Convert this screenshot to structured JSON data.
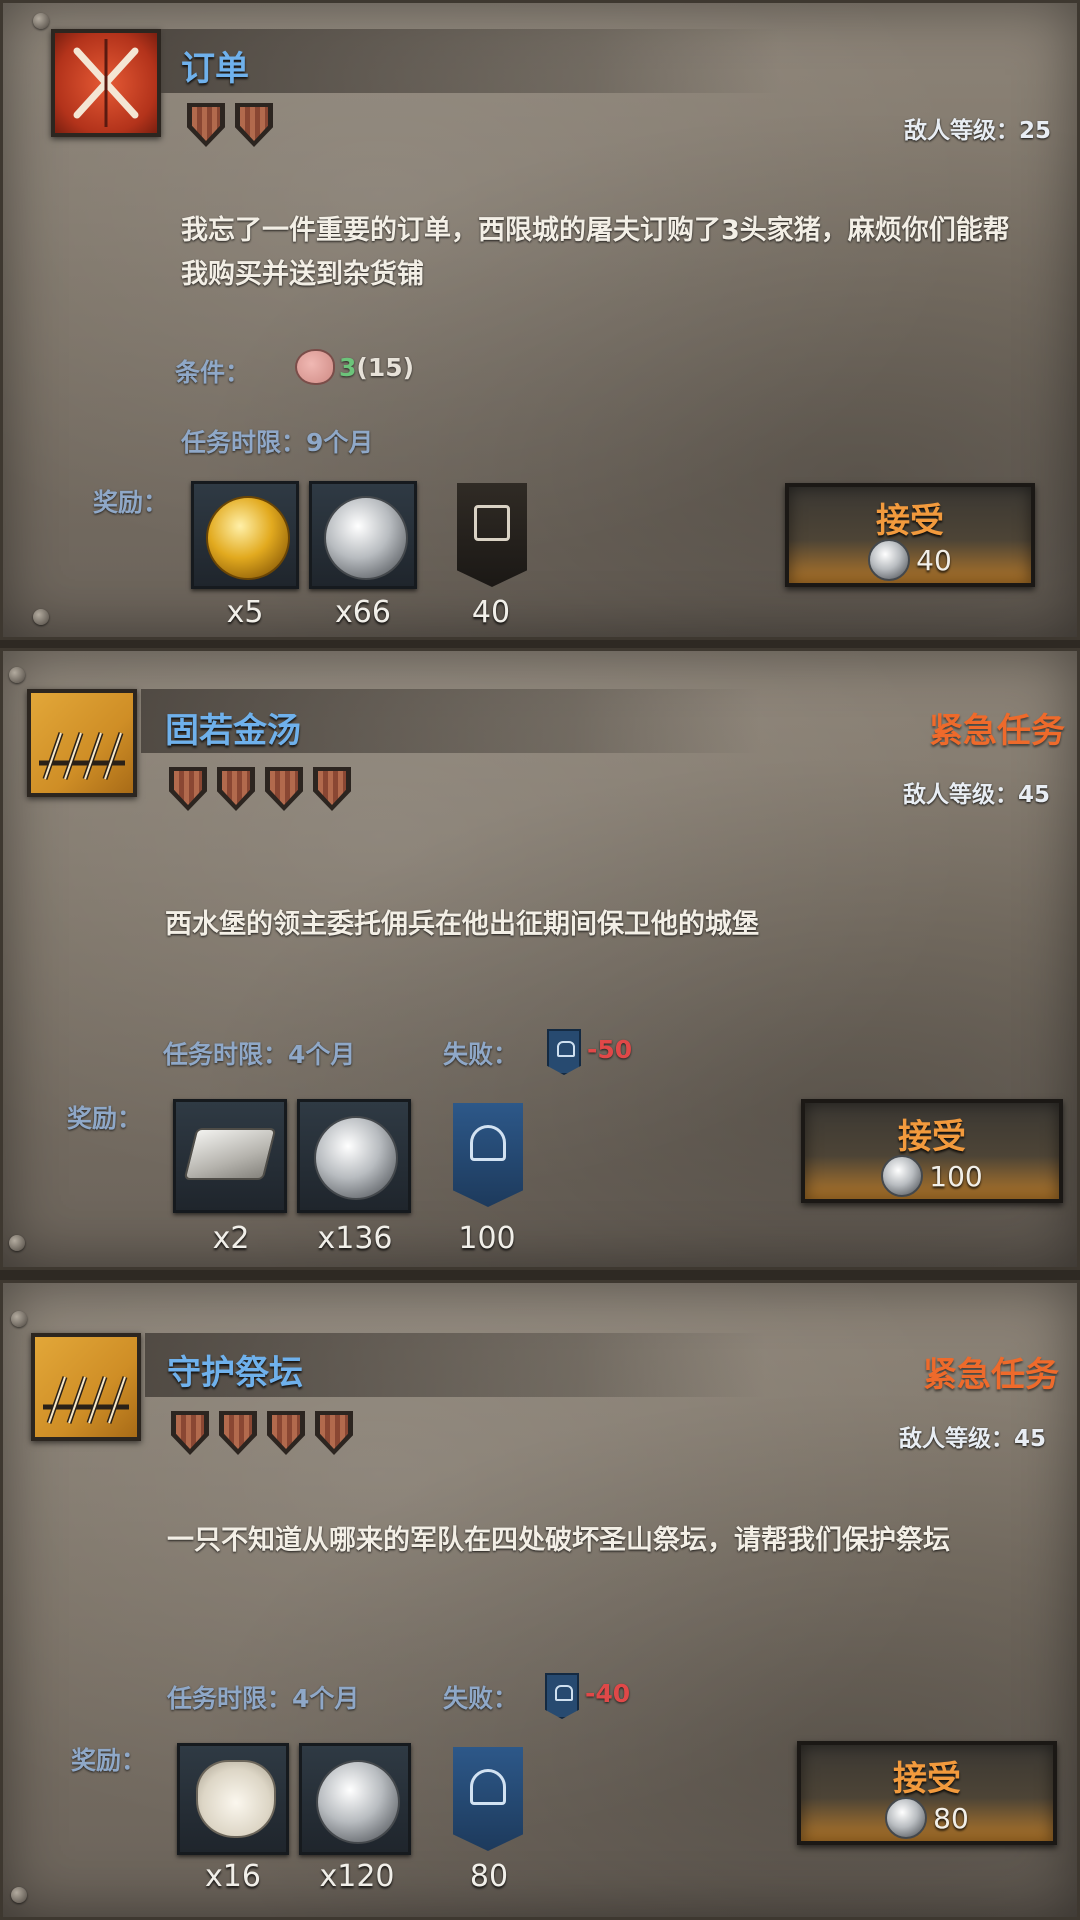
{
  "labels": {
    "enemy_level_prefix": "敌人等级：",
    "condition": "条件：",
    "time_limit": "任务时限：",
    "fail": "失败：",
    "reward": "奖励：",
    "accept": "接受",
    "urgent": "紧急任务"
  },
  "quests": [
    {
      "title": "订单",
      "difficulty_shields": 2,
      "enemy_level": "25",
      "urgent": false,
      "description": "我忘了一件重要的订单，西限城的屠夫订购了3头家猪，麻烦你们能帮我购买并送到杂货铺",
      "condition": {
        "icon": "pig-icon",
        "have": "3",
        "need": "(15)"
      },
      "time_limit": "9个月",
      "rewards": [
        {
          "type": "gold-coin-icon",
          "text": "x5"
        },
        {
          "type": "silver-coin-icon",
          "text": "x66"
        },
        {
          "type": "dark-banner-icon",
          "text": "40"
        }
      ],
      "accept_cost": "40"
    },
    {
      "title": "固若金汤",
      "difficulty_shields": 4,
      "enemy_level": "45",
      "urgent": true,
      "description": "西水堡的领主委托佣兵在他出征期间保卫他的城堡",
      "time_limit": "4个月",
      "fail_penalty": "-50",
      "rewards": [
        {
          "type": "silver-ingot-icon",
          "text": "x2"
        },
        {
          "type": "silver-coin-icon",
          "text": "x136"
        },
        {
          "type": "blue-castle-banner-icon",
          "text": "100"
        }
      ],
      "accept_cost": "100"
    },
    {
      "title": "守护祭坛",
      "difficulty_shields": 4,
      "enemy_level": "45",
      "urgent": true,
      "description": "一只不知道从哪来的军队在四处破坏圣山祭坛，请帮我们保护祭坛",
      "time_limit": "4个月",
      "fail_penalty": "-40",
      "rewards": [
        {
          "type": "sheep-icon",
          "text": "x16"
        },
        {
          "type": "silver-coin-icon",
          "text": "x120"
        },
        {
          "type": "blue-castle-banner-icon",
          "text": "80"
        }
      ],
      "accept_cost": "80"
    }
  ]
}
